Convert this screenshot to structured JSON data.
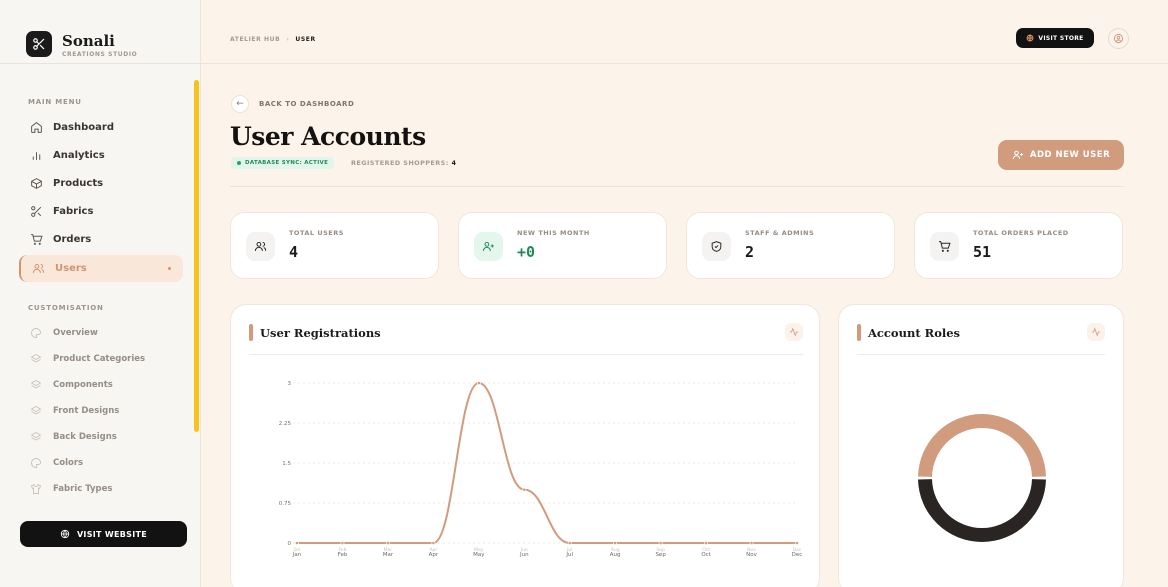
{
  "brand": {
    "name": "Sonali",
    "subtitle": "CREATIONS STUDIO",
    "logo_icon": "scissors-icon"
  },
  "sidebar": {
    "main_label": "MAIN MENU",
    "main_items": [
      {
        "label": "Dashboard",
        "icon": "home-icon"
      },
      {
        "label": "Analytics",
        "icon": "bar-chart-icon"
      },
      {
        "label": "Products",
        "icon": "box-icon"
      },
      {
        "label": "Fabrics",
        "icon": "scissors-icon"
      },
      {
        "label": "Orders",
        "icon": "cart-icon"
      },
      {
        "label": "Users",
        "icon": "users-icon",
        "active": true
      }
    ],
    "custom_label": "CUSTOMISATION",
    "custom_items": [
      {
        "label": "Overview",
        "icon": "palette-icon"
      },
      {
        "label": "Product Categories",
        "icon": "layers-icon"
      },
      {
        "label": "Components",
        "icon": "layers-icon"
      },
      {
        "label": "Front Designs",
        "icon": "layers-icon"
      },
      {
        "label": "Back Designs",
        "icon": "layers-icon"
      },
      {
        "label": "Colors",
        "icon": "palette-icon"
      },
      {
        "label": "Fabric Types",
        "icon": "shirt-icon"
      }
    ],
    "visit_website": "VISIT WEBSITE"
  },
  "topbar": {
    "breadcrumb": [
      "ATELIER HUB",
      "USER"
    ],
    "visit_store": "VISIT STORE"
  },
  "header": {
    "back_label": "BACK TO DASHBOARD",
    "title": "User Accounts",
    "sync_badge": "DATABASE SYNC: ACTIVE",
    "shoppers_label": "REGISTERED SHOPPERS:",
    "shoppers_count": "4",
    "add_user": "ADD NEW USER"
  },
  "stats": [
    {
      "label": "TOTAL USERS",
      "value": "4",
      "icon": "users-icon"
    },
    {
      "label": "NEW THIS MONTH",
      "value": "+0",
      "icon": "user-plus-icon",
      "highlight": true
    },
    {
      "label": "STAFF & ADMINS",
      "value": "2",
      "icon": "shield-icon"
    },
    {
      "label": "TOTAL ORDERS PLACED",
      "value": "51",
      "icon": "cart-icon"
    }
  ],
  "registrations": {
    "title": "User Registrations",
    "icon": "activity-icon"
  },
  "roles": {
    "title": "Account Roles",
    "icon": "activity-icon"
  },
  "colors": {
    "accent": "#d19b7e",
    "dark": "#2a2522",
    "active_green": "#1f8a55",
    "scrollbar": "#f7c21e"
  },
  "chart_data": [
    {
      "type": "line",
      "title": "User Registrations",
      "categories": [
        "Jan",
        "Feb",
        "Mar",
        "Apr",
        "May",
        "Jun",
        "Jul",
        "Aug",
        "Sep",
        "Oct",
        "Nov",
        "Dec"
      ],
      "values": [
        0,
        0,
        0,
        0,
        3,
        1,
        0,
        0,
        0,
        0,
        0,
        0
      ],
      "y_ticks": [
        "0",
        "0.75",
        "1.5",
        "2.25",
        "3"
      ],
      "ylim": [
        0,
        3
      ],
      "grid": true,
      "smooth": true
    },
    {
      "type": "pie",
      "title": "Account Roles",
      "donut": true,
      "values": [
        2,
        2
      ],
      "colors": [
        "#d19b7e",
        "#2a2522"
      ]
    }
  ]
}
